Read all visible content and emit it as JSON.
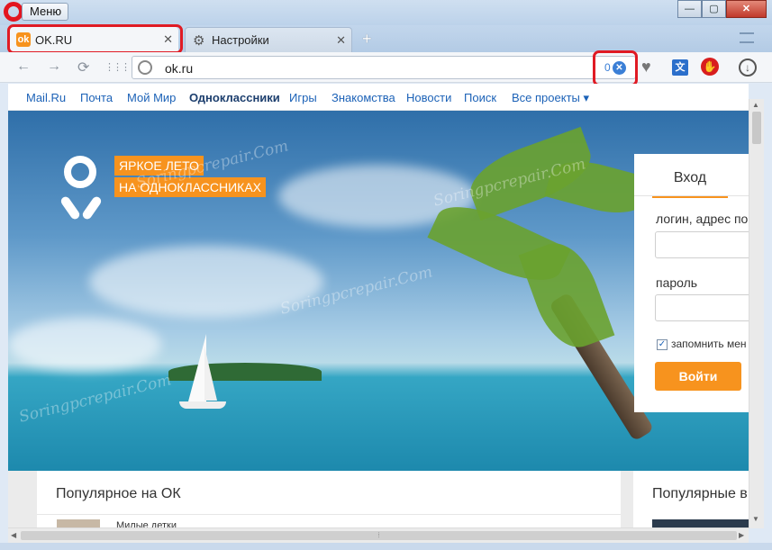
{
  "window": {
    "menu_label": "Меню",
    "min_glyph": "—",
    "max_glyph": "▢",
    "close_glyph": "✕"
  },
  "tabs": [
    {
      "label": "OK.RU",
      "icon": "ok-favicon",
      "active": true
    },
    {
      "label": "Настройки",
      "icon": "gear-icon",
      "active": false
    }
  ],
  "tab_close_glyph": "✕",
  "new_tab_glyph": "+",
  "address": {
    "url": "ok.ru",
    "ghostery_count": "0",
    "ghostery_glyph": "✕"
  },
  "nav_icons": {
    "back": "←",
    "forward": "→",
    "reload": "⟳",
    "speed_dial": "⋮⋮⋮"
  },
  "extensions": {
    "heart": "♥",
    "translate": "文",
    "adblock": "✋",
    "download": "↓"
  },
  "portal_nav": [
    "Mail.Ru",
    "Почта",
    "Мой Мир",
    "Одноклассники",
    "Игры",
    "Знакомства",
    "Новости",
    "Поиск",
    "Все проекты ▾"
  ],
  "promo": {
    "line1": "ЯРКОЕ ЛЕТО",
    "line2": "НА ОДНОКЛАССНИКАХ"
  },
  "login": {
    "tab": "Вход",
    "login_label": "логин, адрес по",
    "password_label": "пароль",
    "remember_label": "запомнить мен",
    "remember_checked": "✓",
    "submit": "Войти"
  },
  "popular": {
    "title": "Популярное на ОК",
    "item": "Милые детки",
    "title2": "Популярные в"
  },
  "watermark": "Soringpcrepair.Com",
  "colors": {
    "ok_orange": "#f7931e",
    "opera_red": "#e3151f",
    "highlight_ring": "#e01b24",
    "link_blue": "#1c62b7"
  }
}
